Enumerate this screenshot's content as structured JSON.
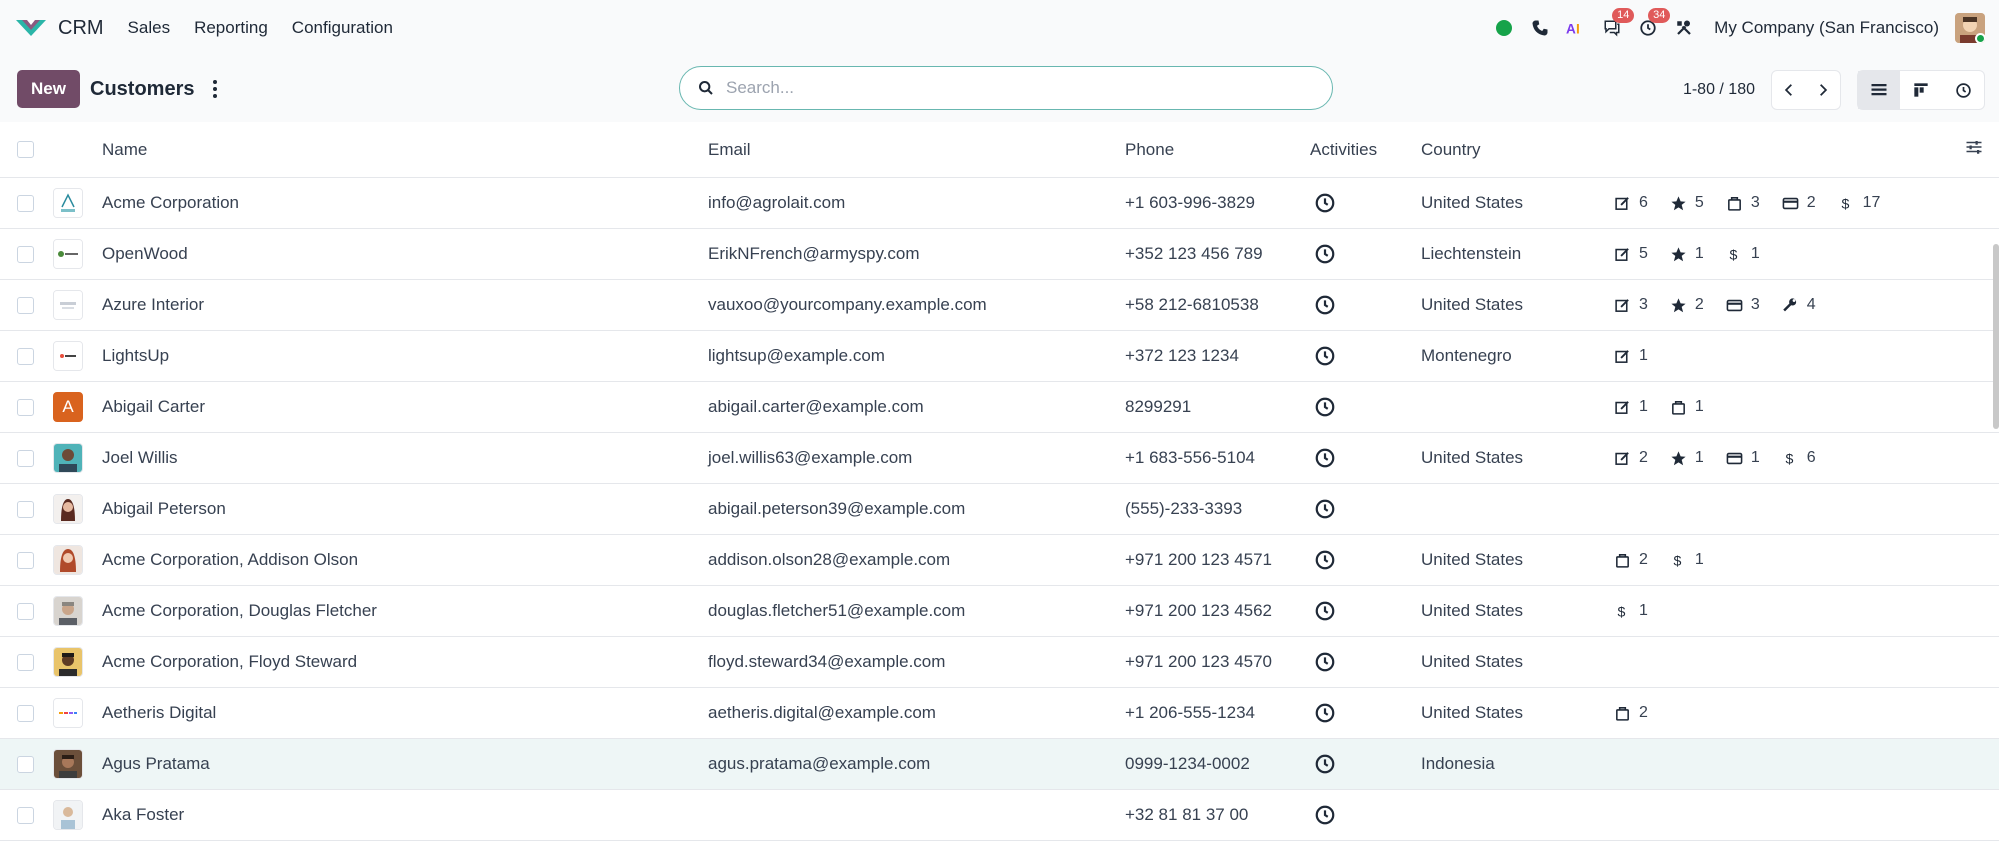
{
  "app": {
    "name": "CRM"
  },
  "menu": [
    "Sales",
    "Reporting",
    "Configuration"
  ],
  "systray": {
    "messages_count": "14",
    "activities_count": "34",
    "company": "My Company (San Francisco)"
  },
  "control": {
    "new_label": "New",
    "title": "Customers",
    "search_placeholder": "Search...",
    "pager": "1-80 / 180"
  },
  "columns": {
    "name": "Name",
    "email": "Email",
    "phone": "Phone",
    "activities": "Activities",
    "country": "Country"
  },
  "colors": {
    "brand": "#714b67",
    "accent": "#68b7b0",
    "online": "#16a34a",
    "badge": "#e05a5a"
  },
  "rows": [
    {
      "name": "Acme Corporation",
      "email": "info@agrolait.com",
      "phone": "+1 603-996-3829",
      "country": "United States",
      "avatar": "logo-acme",
      "stats": [
        {
          "icon": "edit-icon",
          "v": "6"
        },
        {
          "icon": "star-icon",
          "v": "5"
        },
        {
          "icon": "bag-icon",
          "v": "3"
        },
        {
          "icon": "card-icon",
          "v": "2"
        },
        {
          "icon": "dollar-icon",
          "v": "17"
        }
      ]
    },
    {
      "name": "OpenWood",
      "email": "ErikNFrench@armyspy.com",
      "phone": "+352 123 456 789",
      "country": "Liechtenstein",
      "avatar": "logo-openwood",
      "stats": [
        {
          "icon": "edit-icon",
          "v": "5"
        },
        {
          "icon": "star-icon",
          "v": "1"
        },
        {
          "icon": "dollar-icon",
          "v": "1"
        }
      ]
    },
    {
      "name": "Azure Interior",
      "email": "vauxoo@yourcompany.example.com",
      "phone": "+58 212-6810538",
      "country": "United States",
      "avatar": "logo-azure",
      "stats": [
        {
          "icon": "edit-icon",
          "v": "3"
        },
        {
          "icon": "star-icon",
          "v": "2"
        },
        {
          "icon": "card-icon",
          "v": "3"
        },
        {
          "icon": "wrench-icon",
          "v": "4"
        }
      ]
    },
    {
      "name": "LightsUp",
      "email": "lightsup@example.com",
      "phone": "+372 123 1234",
      "country": "Montenegro",
      "avatar": "logo-lightsup",
      "stats": [
        {
          "icon": "edit-icon",
          "v": "1"
        }
      ]
    },
    {
      "name": "Abigail Carter",
      "email": "abigail.carter@example.com",
      "phone": "8299291",
      "country": "",
      "avatar": "letter-a",
      "avatar_letter": "A",
      "stats": [
        {
          "icon": "edit-icon",
          "v": "1"
        },
        {
          "icon": "bag-icon",
          "v": "1"
        }
      ]
    },
    {
      "name": "Joel Willis",
      "email": "joel.willis63@example.com",
      "phone": "+1 683-556-5104",
      "country": "United States",
      "avatar": "photo-teal",
      "stats": [
        {
          "icon": "edit-icon",
          "v": "2"
        },
        {
          "icon": "star-icon",
          "v": "1"
        },
        {
          "icon": "card-icon",
          "v": "1"
        },
        {
          "icon": "dollar-icon",
          "v": "6"
        }
      ]
    },
    {
      "name": "Abigail Peterson",
      "email": "abigail.peterson39@example.com",
      "phone": "(555)-233-3393",
      "country": "",
      "avatar": "photo-woman",
      "stats": []
    },
    {
      "name": "Acme Corporation, Addison Olson",
      "email": "addison.olson28@example.com",
      "phone": "+971 200 123 4571",
      "country": "United States",
      "avatar": "photo-redhair",
      "stats": [
        {
          "icon": "bag-icon",
          "v": "2"
        },
        {
          "icon": "dollar-icon",
          "v": "1"
        }
      ]
    },
    {
      "name": "Acme Corporation, Douglas Fletcher",
      "email": "douglas.fletcher51@example.com",
      "phone": "+971 200 123 4562",
      "country": "United States",
      "avatar": "photo-grey",
      "stats": [
        {
          "icon": "dollar-icon",
          "v": "1"
        }
      ]
    },
    {
      "name": "Acme Corporation, Floyd Steward",
      "email": "floyd.steward34@example.com",
      "phone": "+971 200 123 4570",
      "country": "United States",
      "avatar": "photo-dark",
      "stats": []
    },
    {
      "name": "Aetheris Digital",
      "email": "aetheris.digital@example.com",
      "phone": "+1 206-555-1234",
      "country": "United States",
      "avatar": "logo-aetheris",
      "stats": [
        {
          "icon": "bag-icon",
          "v": "2"
        }
      ]
    },
    {
      "name": "Agus Pratama",
      "email": "agus.pratama@example.com",
      "phone": "0999-1234-0002",
      "country": "Indonesia",
      "avatar": "photo-brown",
      "highlight": true,
      "stats": []
    },
    {
      "name": "Aka Foster",
      "email": "",
      "phone": "+32 81 81 37 00",
      "country": "",
      "avatar": "photo-light",
      "stats": []
    }
  ]
}
